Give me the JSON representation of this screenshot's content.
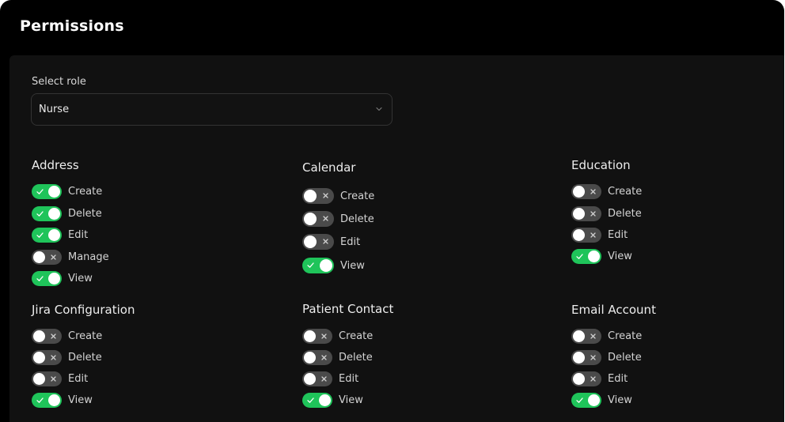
{
  "header": {
    "title": "Permissions"
  },
  "role_select": {
    "label": "Select role",
    "value": "Nurse"
  },
  "colors": {
    "on": "#1fc45a",
    "off": "#4a4a4a",
    "background": "#000000",
    "panel": "#111111"
  },
  "groups": [
    {
      "title": "Address",
      "permissions": [
        {
          "label": "Create",
          "enabled": true
        },
        {
          "label": "Delete",
          "enabled": true
        },
        {
          "label": "Edit",
          "enabled": true
        },
        {
          "label": "Manage",
          "enabled": false
        },
        {
          "label": "View",
          "enabled": true
        }
      ]
    },
    {
      "title": "Calendar",
      "permissions": [
        {
          "label": "Create",
          "enabled": false
        },
        {
          "label": "Delete",
          "enabled": false
        },
        {
          "label": "Edit",
          "enabled": false
        },
        {
          "label": "View",
          "enabled": true
        }
      ]
    },
    {
      "title": "Education",
      "permissions": [
        {
          "label": "Create",
          "enabled": false
        },
        {
          "label": "Delete",
          "enabled": false
        },
        {
          "label": "Edit",
          "enabled": false
        },
        {
          "label": "View",
          "enabled": true
        }
      ]
    },
    {
      "title": "Jira Configuration",
      "permissions": [
        {
          "label": "Create",
          "enabled": false
        },
        {
          "label": "Delete",
          "enabled": false
        },
        {
          "label": "Edit",
          "enabled": false
        },
        {
          "label": "View",
          "enabled": true
        }
      ]
    },
    {
      "title": "Patient Contact",
      "permissions": [
        {
          "label": "Create",
          "enabled": false
        },
        {
          "label": "Delete",
          "enabled": false
        },
        {
          "label": "Edit",
          "enabled": false
        },
        {
          "label": "View",
          "enabled": true
        }
      ]
    },
    {
      "title": "Email Account",
      "permissions": [
        {
          "label": "Create",
          "enabled": false
        },
        {
          "label": "Delete",
          "enabled": false
        },
        {
          "label": "Edit",
          "enabled": false
        },
        {
          "label": "View",
          "enabled": true
        }
      ]
    }
  ]
}
